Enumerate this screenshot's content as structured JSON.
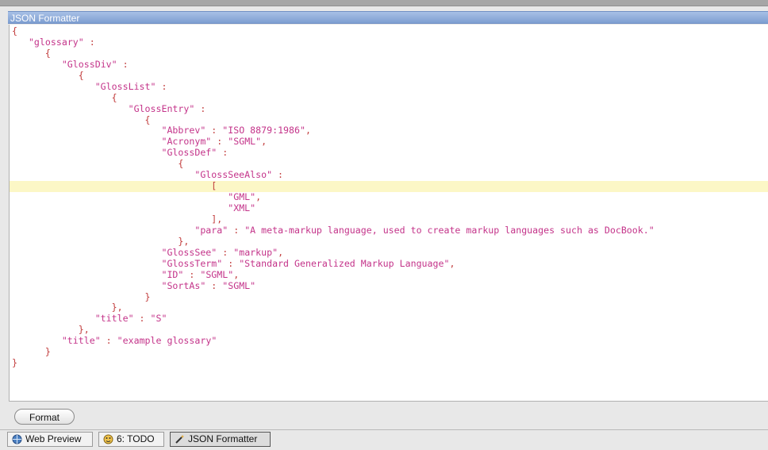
{
  "window": {
    "title": "JSON Formatter"
  },
  "editor": {
    "lines": [
      [
        [
          "p",
          "{"
        ]
      ],
      [
        [
          "p",
          "   "
        ],
        [
          "k",
          "\"glossary\""
        ],
        [
          "p",
          " :"
        ]
      ],
      [
        [
          "p",
          "      {"
        ]
      ],
      [
        [
          "p",
          "         "
        ],
        [
          "k",
          "\"GlossDiv\""
        ],
        [
          "p",
          " :"
        ]
      ],
      [
        [
          "p",
          "            {"
        ]
      ],
      [
        [
          "p",
          "               "
        ],
        [
          "k",
          "\"GlossList\""
        ],
        [
          "p",
          " :"
        ]
      ],
      [
        [
          "p",
          "                  {"
        ]
      ],
      [
        [
          "p",
          "                     "
        ],
        [
          "k",
          "\"GlossEntry\""
        ],
        [
          "p",
          " :"
        ]
      ],
      [
        [
          "p",
          "                        {"
        ]
      ],
      [
        [
          "p",
          "                           "
        ],
        [
          "k",
          "\"Abbrev\""
        ],
        [
          "p",
          " : "
        ],
        [
          "k",
          "\"ISO 8879:1986\""
        ],
        [
          "p",
          ","
        ]
      ],
      [
        [
          "p",
          "                           "
        ],
        [
          "k",
          "\"Acronym\""
        ],
        [
          "p",
          " : "
        ],
        [
          "k",
          "\"SGML\""
        ],
        [
          "p",
          ","
        ]
      ],
      [
        [
          "p",
          "                           "
        ],
        [
          "k",
          "\"GlossDef\""
        ],
        [
          "p",
          " :"
        ]
      ],
      [
        [
          "p",
          "                              {"
        ]
      ],
      [
        [
          "p",
          "                                 "
        ],
        [
          "k",
          "\"GlossSeeAlso\""
        ],
        [
          "p",
          " :"
        ]
      ],
      [
        [
          "p",
          "                                    ["
        ]
      ],
      [
        [
          "p",
          "                                       "
        ],
        [
          "k",
          "\"GML\""
        ],
        [
          "p",
          ","
        ]
      ],
      [
        [
          "p",
          "                                       "
        ],
        [
          "k",
          "\"XML\""
        ]
      ],
      [
        [
          "p",
          "                                    ],"
        ]
      ],
      [
        [
          "p",
          "                                 "
        ],
        [
          "k",
          "\"para\""
        ],
        [
          "p",
          " : "
        ],
        [
          "k",
          "\"A meta-markup language, used to create markup languages such as DocBook.\""
        ]
      ],
      [
        [
          "p",
          "                              },"
        ]
      ],
      [
        [
          "p",
          "                           "
        ],
        [
          "k",
          "\"GlossSee\""
        ],
        [
          "p",
          " : "
        ],
        [
          "k",
          "\"markup\""
        ],
        [
          "p",
          ","
        ]
      ],
      [
        [
          "p",
          "                           "
        ],
        [
          "k",
          "\"GlossTerm\""
        ],
        [
          "p",
          " : "
        ],
        [
          "k",
          "\"Standard Generalized Markup Language\""
        ],
        [
          "p",
          ","
        ]
      ],
      [
        [
          "p",
          "                           "
        ],
        [
          "k",
          "\"ID\""
        ],
        [
          "p",
          " : "
        ],
        [
          "k",
          "\"SGML\""
        ],
        [
          "p",
          ","
        ]
      ],
      [
        [
          "p",
          "                           "
        ],
        [
          "k",
          "\"SortAs\""
        ],
        [
          "p",
          " : "
        ],
        [
          "k",
          "\"SGML\""
        ]
      ],
      [
        [
          "p",
          "                        }"
        ]
      ],
      [
        [
          "p",
          "                  },"
        ]
      ],
      [
        [
          "p",
          "               "
        ],
        [
          "k",
          "\"title\""
        ],
        [
          "p",
          " : "
        ],
        [
          "k",
          "\"S\""
        ]
      ],
      [
        [
          "p",
          "            },"
        ]
      ],
      [
        [
          "p",
          "         "
        ],
        [
          "k",
          "\"title\""
        ],
        [
          "p",
          " : "
        ],
        [
          "k",
          "\"example glossary\""
        ]
      ],
      [
        [
          "p",
          "      }"
        ]
      ],
      [
        [
          "p",
          "}"
        ]
      ]
    ],
    "highlighted_line": 15
  },
  "format_button": {
    "label": "Format"
  },
  "tool_tabs": [
    {
      "label": "Web Preview",
      "icon": "web-preview-icon"
    },
    {
      "label": "6: TODO",
      "icon": "todo-icon"
    },
    {
      "label": "JSON Formatter",
      "icon": "wand-icon"
    }
  ],
  "colors": {
    "key": "#c4348a",
    "punct": "#c23d3d",
    "highlight": "#fcf7c6",
    "title_bar": "#7d9ed1"
  }
}
